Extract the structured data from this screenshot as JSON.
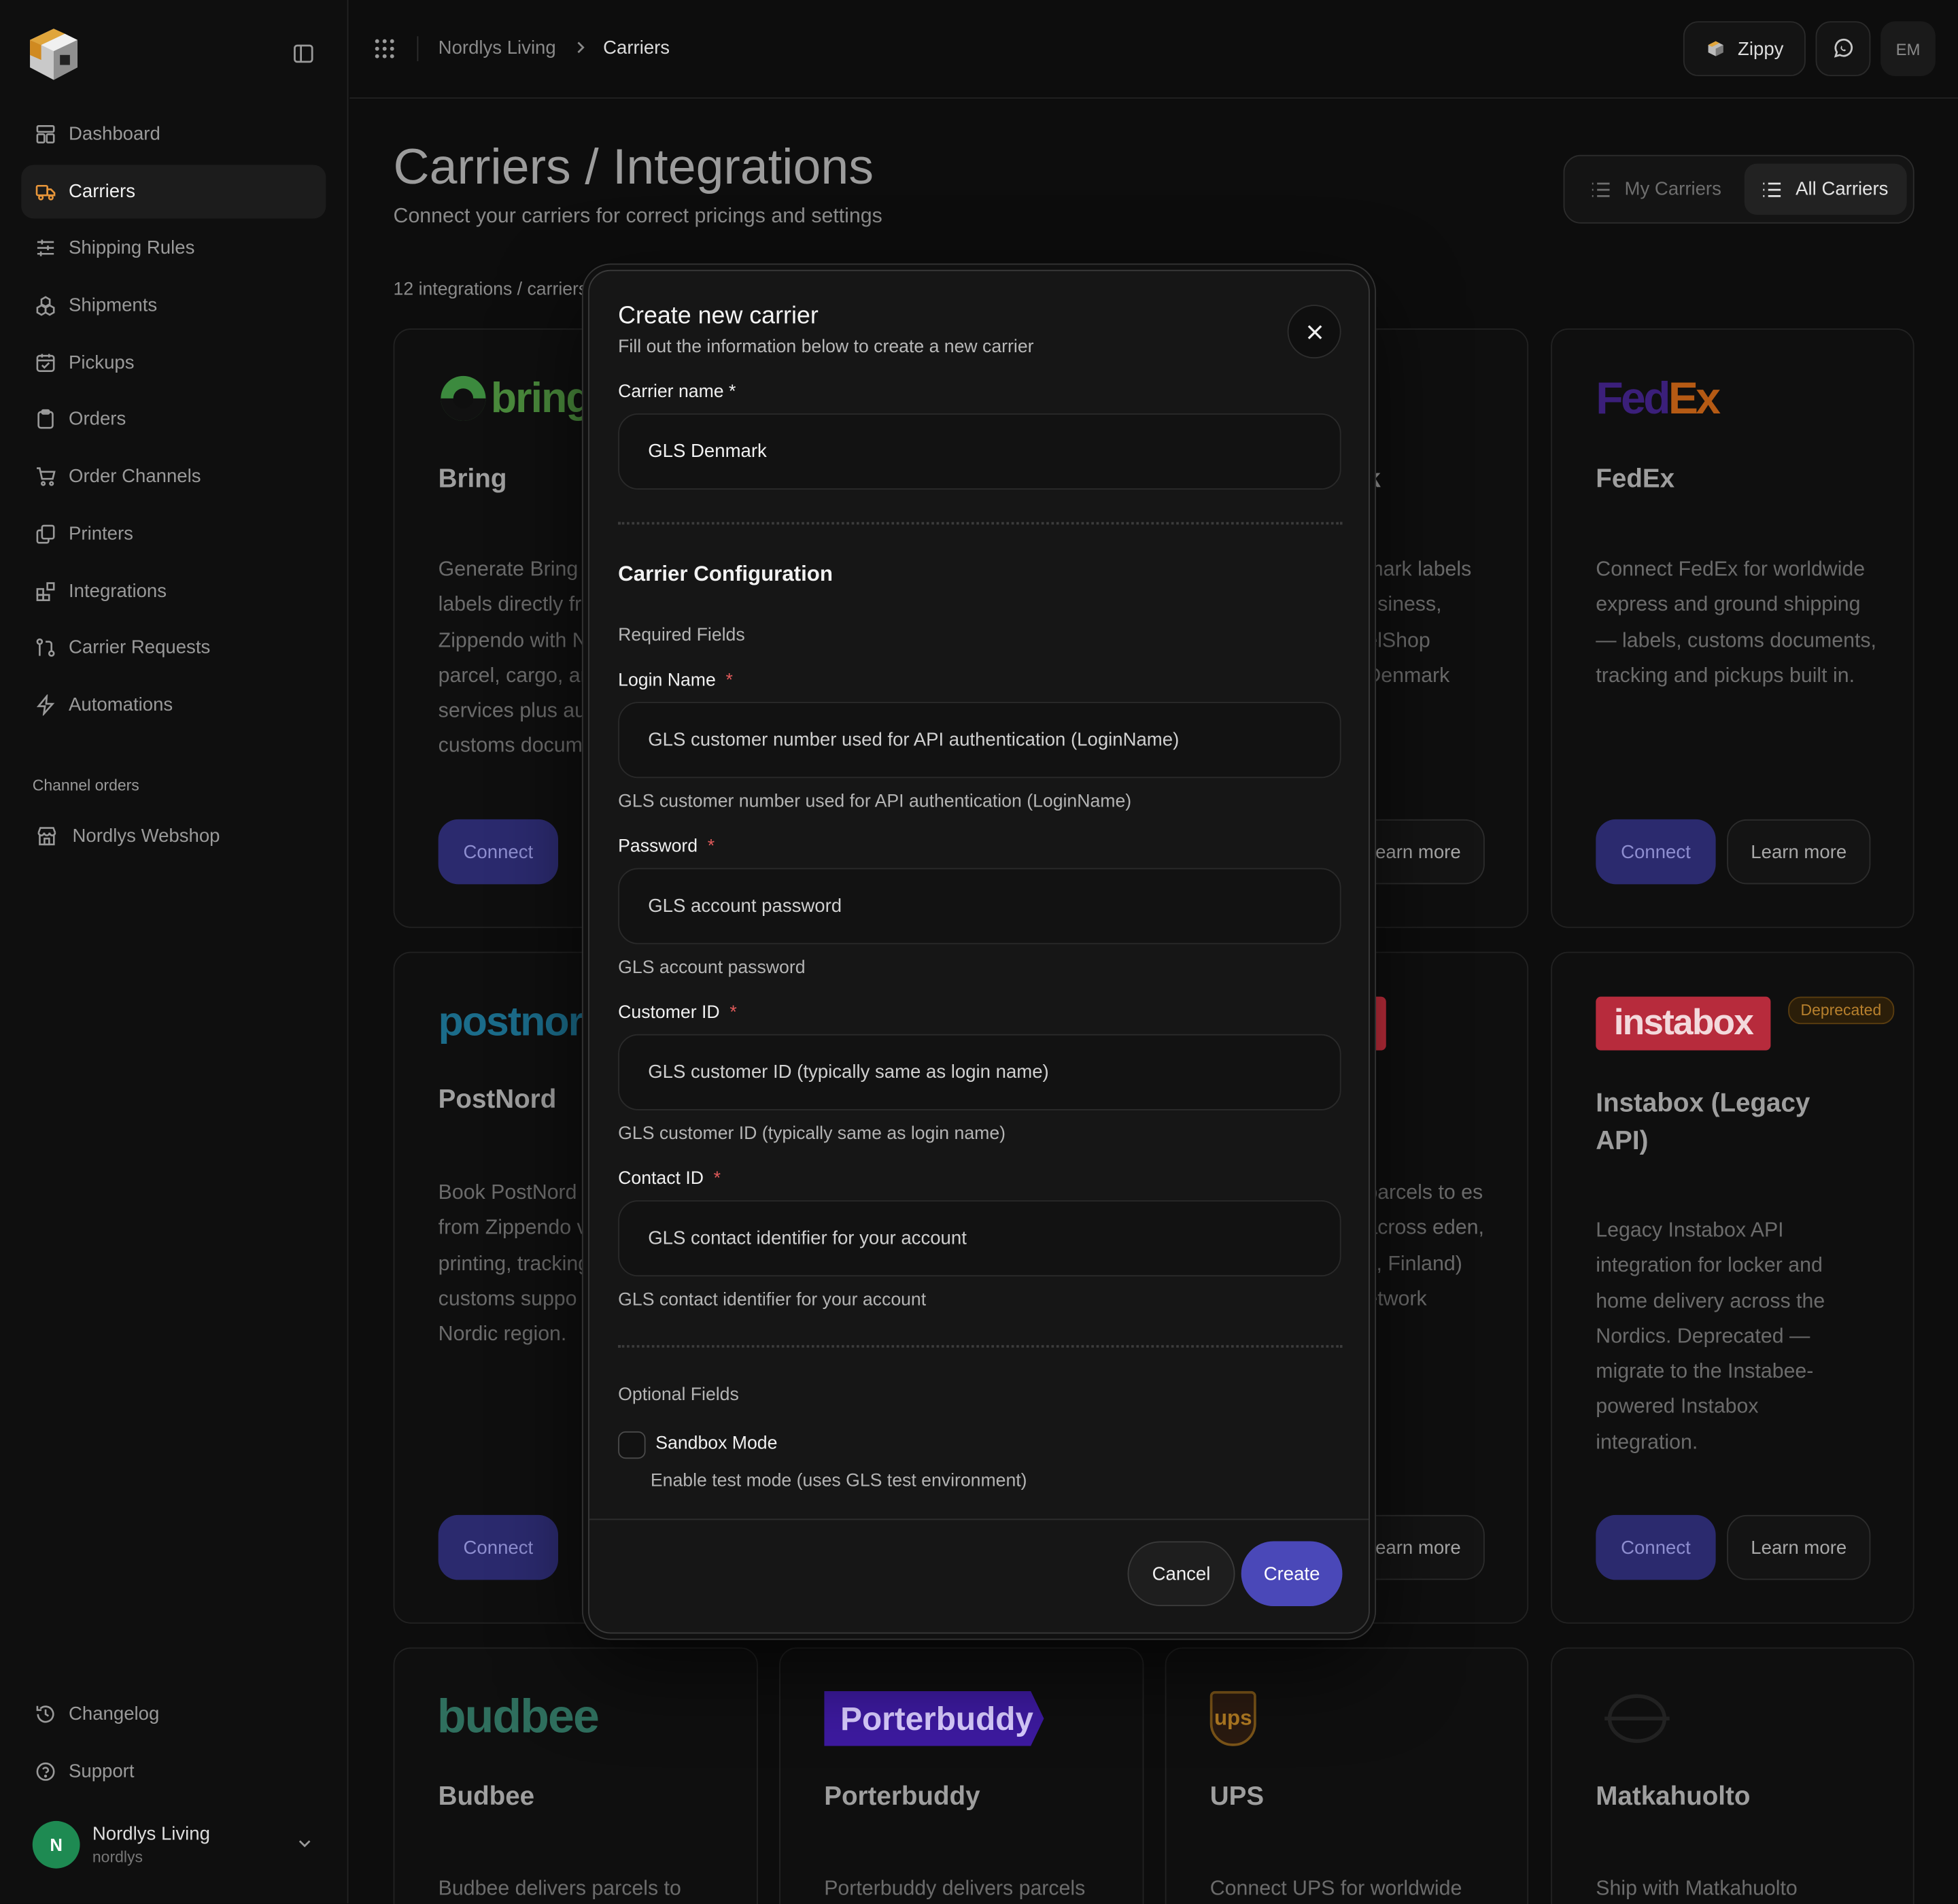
{
  "sidebar": {
    "nav": [
      {
        "label": "Dashboard",
        "icon": "dashboard-icon"
      },
      {
        "label": "Carriers",
        "icon": "truck-icon"
      },
      {
        "label": "Shipping Rules",
        "icon": "sliders-icon"
      },
      {
        "label": "Shipments",
        "icon": "boxes-icon"
      },
      {
        "label": "Pickups",
        "icon": "calendar-icon"
      },
      {
        "label": "Orders",
        "icon": "clipboard-icon"
      },
      {
        "label": "Order Channels",
        "icon": "cart-icon"
      },
      {
        "label": "Printers",
        "icon": "printer-icon"
      },
      {
        "label": "Integrations",
        "icon": "blocks-icon"
      },
      {
        "label": "Carrier Requests",
        "icon": "git-pull-request-icon"
      },
      {
        "label": "Automations",
        "icon": "zap-icon"
      }
    ],
    "section_label": "Channel orders",
    "channel": "Nordlys Webshop",
    "bottom": [
      {
        "label": "Changelog",
        "icon": "history-icon"
      },
      {
        "label": "Support",
        "icon": "help-circle-icon"
      }
    ],
    "user": {
      "initial": "N",
      "name": "Nordlys Living",
      "handle": "nordlys"
    }
  },
  "topbar": {
    "breadcrumb": [
      "Nordlys Living",
      "Carriers"
    ],
    "zippy": "Zippy",
    "user_initials": "EM"
  },
  "page": {
    "title": "Carriers / Integrations",
    "subtitle": "Connect your carriers for correct pricings and settings",
    "count": "12 integrations / carriers",
    "toggle": {
      "my": "My Carriers",
      "all": "All Carriers"
    }
  },
  "cards": {
    "bring": {
      "logo": "bring",
      "title": "Bring",
      "desc": "Generate Bring labels directly from Zippendo with N parcel, cargo, an services plus au customs docum",
      "connect": "Connect"
    },
    "fedex": {
      "logo_fed": "Fed",
      "logo_ex": "Ex",
      "title": "FedEx",
      "desc": "Connect FedEx for worldwide express and ground shipping — labels, customs documents, tracking and pickups built in.",
      "connect": "Connect",
      "learn": "Learn more"
    },
    "pdk": {
      "title_frag": "k",
      "desc": "mark labels usiness, elShop Denmark",
      "learn": "Learn more"
    },
    "postnord": {
      "logo": "postnor",
      "title": "PostNord",
      "desc": "Book PostNord from Zippendo v printing, tracking customs suppo Nordic region.",
      "connect": "Connect"
    },
    "airmee": {
      "desc": "parcels to es across eden, k, Finland) etwork",
      "learn": "Learn more"
    },
    "instabox": {
      "logo": "instabox",
      "badge": "Deprecated",
      "title": "Instabox (Legacy API)",
      "desc": "Legacy Instabox API integration for locker and home delivery across the Nordics. Deprecated — migrate to the Instabee-powered Instabox integration.",
      "connect": "Connect",
      "learn": "Learn more"
    },
    "budbee": {
      "logo": "budbee",
      "title": "Budbee",
      "desc": "Budbee delivers parcels to"
    },
    "porterbuddy": {
      "logo": "Porterbuddy",
      "title": "Porterbuddy",
      "desc": "Porterbuddy delivers parcels"
    },
    "ups": {
      "logo": "ups",
      "title": "UPS",
      "desc": "Connect UPS for worldwide"
    },
    "matkahuolto": {
      "title": "Matkahuolto",
      "desc": "Ship with Matkahuolto"
    }
  },
  "modal": {
    "title": "Create new carrier",
    "subtitle": "Fill out the information below to create a new carrier",
    "carrier_name_label": "Carrier name *",
    "carrier_name_value": "GLS Denmark",
    "section": "Carrier Configuration",
    "required_group": "Required Fields",
    "fields": [
      {
        "label": "Login Name",
        "placeholder": "GLS customer number used for API authentication (LoginName)",
        "help": "GLS customer number used for API authentication (LoginName)"
      },
      {
        "label": "Password",
        "placeholder": "GLS account password",
        "help": "GLS account password"
      },
      {
        "label": "Customer ID",
        "placeholder": "GLS customer ID (typically same as login name)",
        "help": "GLS customer ID (typically same as login name)"
      },
      {
        "label": "Contact ID",
        "placeholder": "GLS contact identifier for your account",
        "help": "GLS contact identifier for your account"
      }
    ],
    "optional_group": "Optional Fields",
    "sandbox_label": "Sandbox Mode",
    "sandbox_help": "Enable test mode (uses GLS test environment)",
    "cancel": "Cancel",
    "create": "Create",
    "required_mark": "*"
  },
  "colors": {
    "accent": "#4a48b8",
    "connect_bg": "#2b2a6e",
    "deprecated": "#b7802d",
    "budbee": "#2f8f77",
    "porterbuddy": "#4b1fc7",
    "instabox": "#d6324a"
  }
}
